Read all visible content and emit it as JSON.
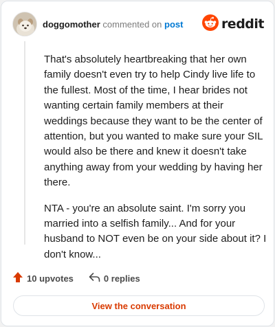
{
  "header": {
    "username": "doggomother",
    "action_text": "commented on",
    "target_link": "post",
    "brand_name": "reddit"
  },
  "comment": {
    "paragraphs": [
      "That's absolutely heartbreaking that her own family doesn't even try to help Cindy live life to the fullest. Most of the time, I hear brides not wanting certain family members at their weddings because they want to be the center of attention, but you wanted to make sure your SIL would also be there and knew it doesn't take anything away from your wedding by having her there.",
      "NTA - you're an absolute saint. I'm sorry you married into a selfish family... And for your husband to NOT even be on your side about it? I don't know..."
    ]
  },
  "stats": {
    "upvotes_label": "10 upvotes",
    "replies_label": "0 replies"
  },
  "footer": {
    "view_conversation_label": "View the conversation"
  },
  "colors": {
    "brand_orange": "#ff4500",
    "link_blue": "#0079d3",
    "button_text": "#d93a00"
  },
  "icons": {
    "avatar": "user-avatar",
    "logo": "reddit-snoo-icon",
    "upvote": "upvote-arrow-icon",
    "reply": "reply-arrow-icon"
  }
}
